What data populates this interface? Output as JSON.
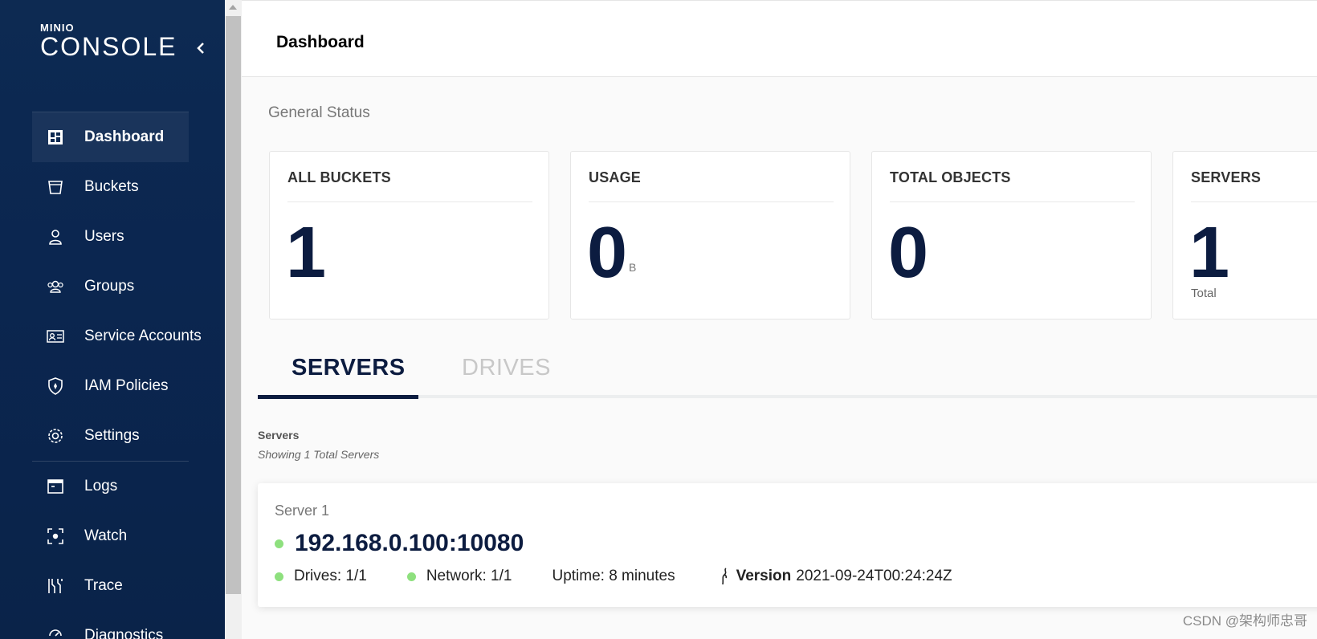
{
  "sidebar": {
    "logo_top": "MINIO",
    "logo_main": "CONSOLE",
    "items": [
      {
        "label": "Dashboard",
        "icon": "dashboard-icon",
        "active": true
      },
      {
        "label": "Buckets",
        "icon": "bucket-icon"
      },
      {
        "label": "Users",
        "icon": "user-icon"
      },
      {
        "label": "Groups",
        "icon": "groups-icon"
      },
      {
        "label": "Service Accounts",
        "icon": "id-card-icon"
      },
      {
        "label": "IAM Policies",
        "icon": "shield-icon"
      },
      {
        "label": "Settings",
        "icon": "gear-icon"
      },
      {
        "label": "Logs",
        "icon": "logs-icon"
      },
      {
        "label": "Watch",
        "icon": "watch-icon"
      },
      {
        "label": "Trace",
        "icon": "trace-icon"
      },
      {
        "label": "Diagnostics",
        "icon": "diagnostics-icon"
      }
    ]
  },
  "header": {
    "title": "Dashboard"
  },
  "general_status": {
    "title": "General Status",
    "cards": [
      {
        "title": "ALL BUCKETS",
        "value": "1"
      },
      {
        "title": "USAGE",
        "value": "0",
        "unit": "B"
      },
      {
        "title": "TOTAL OBJECTS",
        "value": "0"
      },
      {
        "title": "SERVERS",
        "value": "1",
        "sub": "Total"
      }
    ]
  },
  "tabs": [
    {
      "label": "SERVERS",
      "active": true
    },
    {
      "label": "DRIVES",
      "active": false
    }
  ],
  "servers_section": {
    "label": "Servers",
    "subtitle": "Showing 1 Total Servers"
  },
  "server": {
    "name": "Server 1",
    "host": "192.168.0.100:10080",
    "drives": "Drives: 1/1",
    "network": "Network: 1/1",
    "uptime": "Uptime: 8 minutes",
    "version_label": "Version",
    "version": "2021-09-24T00:24:24Z"
  },
  "watermark": "CSDN @架构师忠哥",
  "colors": {
    "sidebar_bg": "#0b2650",
    "accent": "#0c1c40",
    "status_ok": "#8ee07e"
  }
}
